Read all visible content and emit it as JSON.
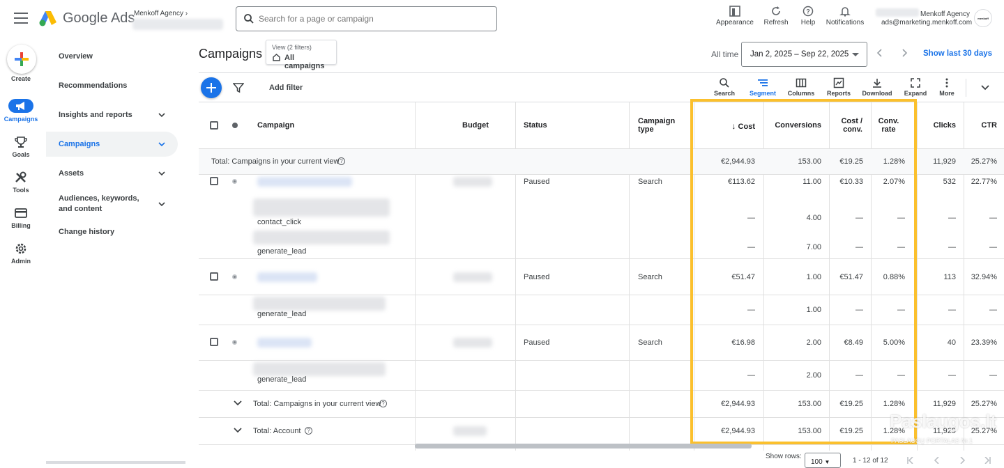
{
  "app": {
    "brand": "Google Ads",
    "account_name": "Menkoff Agency"
  },
  "search": {
    "placeholder": "Search for a page or campaign"
  },
  "top_actions": [
    {
      "label": "Appearance",
      "icon": "appearance-icon"
    },
    {
      "label": "Refresh",
      "icon": "refresh-icon"
    },
    {
      "label": "Help",
      "icon": "help-icon"
    },
    {
      "label": "Notifications",
      "icon": "bell-icon"
    }
  ],
  "user": {
    "name": "Menkoff Agency",
    "email": "ads@marketing.menkoff.com",
    "avatar_text": "menkoff"
  },
  "rail": [
    {
      "label": "Create",
      "icon": "plus-icon"
    },
    {
      "label": "Campaigns",
      "icon": "megaphone-icon"
    },
    {
      "label": "Goals",
      "icon": "trophy-icon"
    },
    {
      "label": "Tools",
      "icon": "tools-icon"
    },
    {
      "label": "Billing",
      "icon": "card-icon"
    },
    {
      "label": "Admin",
      "icon": "gear-icon"
    }
  ],
  "nav": [
    {
      "label": "Overview"
    },
    {
      "label": "Recommendations"
    },
    {
      "label": "Insights and reports"
    },
    {
      "label": "Campaigns"
    },
    {
      "label": "Assets"
    },
    {
      "label": "Audiences, keywords, and content"
    },
    {
      "label": "Change history"
    }
  ],
  "header": {
    "title": "Campaigns",
    "view_sub": "View (2 filters)",
    "view_main": "All campaigns",
    "all_time": "All time",
    "date_range": "Jan 2, 2025 – Sep 22, 2025",
    "show_last": "Show last 30 days"
  },
  "toolbar": {
    "add_filter": "Add filter",
    "tools": [
      {
        "label": "Search",
        "icon": "search-icon"
      },
      {
        "label": "Segment",
        "icon": "segment-icon"
      },
      {
        "label": "Columns",
        "icon": "columns-icon"
      },
      {
        "label": "Reports",
        "icon": "reports-icon"
      },
      {
        "label": "Download",
        "icon": "download-icon"
      },
      {
        "label": "Expand",
        "icon": "expand-icon"
      },
      {
        "label": "More",
        "icon": "more-icon"
      }
    ]
  },
  "table": {
    "columns": {
      "campaign": "Campaign",
      "budget": "Budget",
      "status": "Status",
      "type": "Campaign type",
      "cost": "Cost",
      "conversions": "Conversions",
      "cost_conv": "Cost / conv.",
      "conv_rate": "Conv. rate",
      "clicks": "Clicks",
      "ctr": "CTR"
    },
    "total_top": {
      "label": "Total: Campaigns in your current view",
      "cost": "€2,944.93",
      "conversions": "153.00",
      "cost_conv": "€19.25",
      "conv_rate": "1.28%",
      "clicks": "11,929",
      "ctr": "25.27%"
    },
    "rows": [
      {
        "status": "Paused",
        "type": "Search",
        "cost": "€113.62",
        "conversions": "11.00",
        "cost_conv": "€10.33",
        "conv_rate": "2.07%",
        "clicks": "532",
        "ctr": "22.77%"
      },
      {
        "action": "contact_click",
        "cost": "—",
        "conversions": "4.00",
        "cost_conv": "—",
        "conv_rate": "—",
        "clicks": "—",
        "ctr": "—"
      },
      {
        "action": "generate_lead",
        "cost": "—",
        "conversions": "7.00",
        "cost_conv": "—",
        "conv_rate": "—",
        "clicks": "—",
        "ctr": "—"
      },
      {
        "status": "Paused",
        "type": "Search",
        "cost": "€51.47",
        "conversions": "1.00",
        "cost_conv": "€51.47",
        "conv_rate": "0.88%",
        "clicks": "113",
        "ctr": "32.94%"
      },
      {
        "action": "generate_lead",
        "cost": "—",
        "conversions": "1.00",
        "cost_conv": "—",
        "conv_rate": "—",
        "clicks": "—",
        "ctr": "—"
      },
      {
        "status": "Paused",
        "type": "Search",
        "cost": "€16.98",
        "conversions": "2.00",
        "cost_conv": "€8.49",
        "conv_rate": "5.00%",
        "clicks": "40",
        "ctr": "23.39%"
      },
      {
        "action": "generate_lead",
        "cost": "—",
        "conversions": "2.00",
        "cost_conv": "—",
        "conv_rate": "—",
        "clicks": "—",
        "ctr": "—"
      }
    ],
    "total_view": {
      "label": "Total: Campaigns in your current view",
      "cost": "€2,944.93",
      "conversions": "153.00",
      "cost_conv": "€19.25",
      "conv_rate": "1.28%",
      "clicks": "11,929",
      "ctr": "25.27%"
    },
    "total_account": {
      "label": "Total: Account",
      "cost": "€2,944.93",
      "conversions": "153.00",
      "cost_conv": "€19.25",
      "conv_rate": "1.28%",
      "clicks": "11,929",
      "ctr": "25.27%"
    }
  },
  "footer": {
    "show_rows_label": "Show rows:",
    "rows_value": "100",
    "range": "1 - 12 of 12"
  },
  "watermark": {
    "title": "Paslaugos.lt",
    "subtitle": "PASLAUGŲ PORTALAS Nr.1"
  },
  "colors": {
    "accent": "#1a73e8",
    "highlight": "#fbc02d"
  }
}
